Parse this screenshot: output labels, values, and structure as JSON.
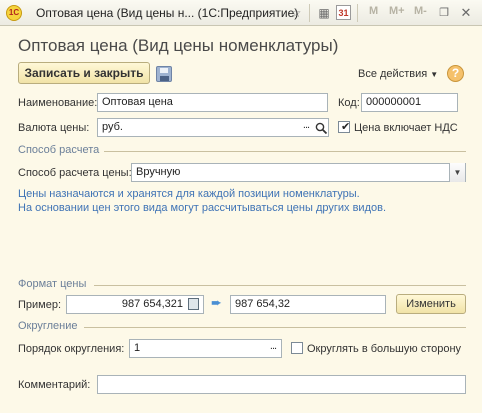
{
  "window": {
    "title": "Оптовая цена (Вид цены н... (1С:Предприятие)",
    "toolbar_icons": [
      "favorite-icon",
      "calculator-icon",
      "calendar-icon",
      "memory-m-icon",
      "memory-mplus-icon",
      "memory-mminus-icon",
      "restore-window-icon",
      "close-window-icon"
    ],
    "memory_labels": [
      "M",
      "M+",
      "M-"
    ],
    "calendar_label": "31"
  },
  "form": {
    "title": "Оптовая цена (Вид цены номенклатуры)",
    "save_close_label": "Записать и закрыть",
    "all_actions_label": "Все действия",
    "help_label": "?"
  },
  "fields": {
    "name_label": "Наименование:",
    "name_value": "Оптовая цена",
    "code_label": "Код:",
    "code_value": "000000001",
    "currency_label": "Валюта цены:",
    "currency_value": "руб.",
    "vat_label": "Цена включает НДС",
    "vat_checked": true
  },
  "calc_section": {
    "title": "Способ расчета",
    "method_label": "Способ расчета цены:",
    "method_value": "Вручную",
    "info_line1": "Цены назначаются и хранятся для каждой позиции номенклатуры.",
    "info_line2": "На основании цен этого вида могут рассчитываться цены других видов."
  },
  "format_section": {
    "title": "Формат цены",
    "example_label": "Пример:",
    "example_value": "987 654,321",
    "result_value": "987 654,32",
    "change_label": "Изменить"
  },
  "rounding_section": {
    "title": "Округление",
    "order_label": "Порядок округления:",
    "order_value": "1",
    "round_up_label": "Округлять в большую сторону",
    "round_up_checked": false
  },
  "comment": {
    "label": "Комментарий:",
    "value": ""
  },
  "colors": {
    "background": "#fdf9e8",
    "section_text": "#6b7f99",
    "info_text": "#3f73b5",
    "button_gradient_top": "#fff8d7",
    "button_gradient_bottom": "#f1e3a7"
  }
}
